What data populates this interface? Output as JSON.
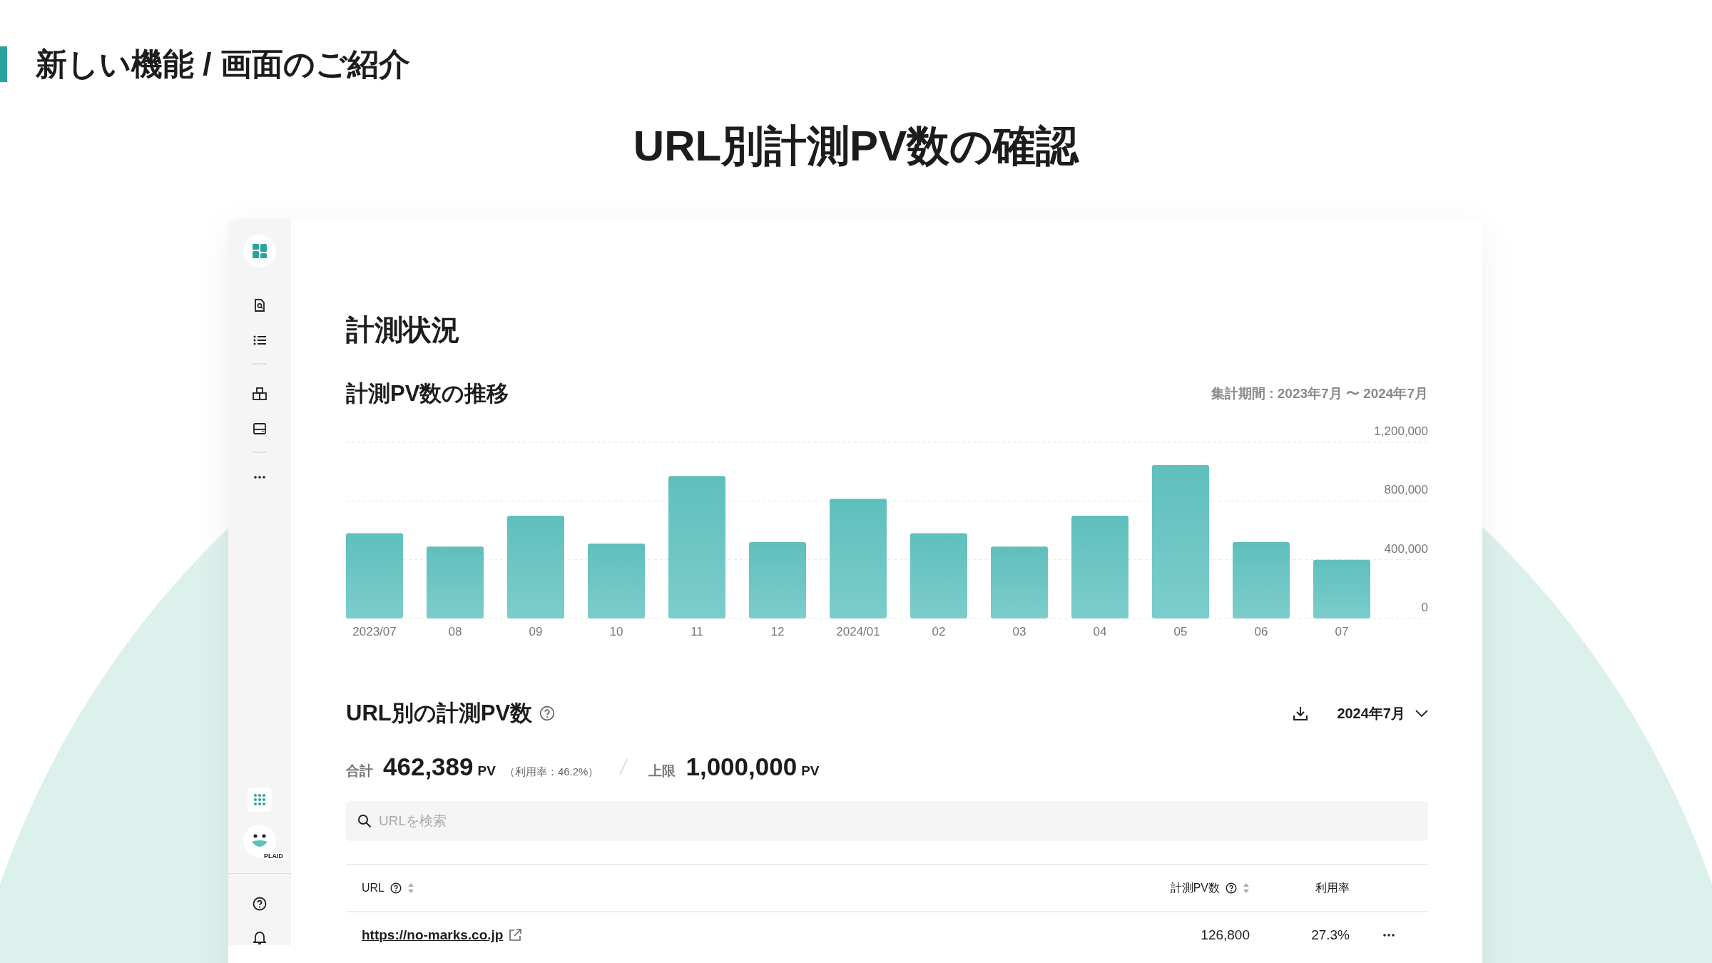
{
  "slide": {
    "heading": "新しい機能 / 画面のご紹介",
    "title": "URL別計測PV数の確認"
  },
  "sidebar": {
    "avatar_badge": "PLAID"
  },
  "page": {
    "title": "計測状況"
  },
  "trend": {
    "title": "計測PV数の推移",
    "period": "集計期間 : 2023年7月 〜 2024年7月",
    "chart_data": {
      "type": "bar",
      "categories": [
        "2023/07",
        "08",
        "09",
        "10",
        "11",
        "12",
        "2024/01",
        "02",
        "03",
        "04",
        "05",
        "06",
        "07"
      ],
      "series": [
        {
          "color": "#5fbfbd",
          "values": [
            580000,
            490000,
            700000,
            510000,
            970000,
            520000,
            815000,
            580000,
            490000,
            700000,
            1045000,
            520000,
            400000
          ]
        }
      ],
      "ylim": [
        0,
        1200000
      ],
      "yticks": [
        {
          "value": 0,
          "label": "0"
        },
        {
          "value": 400000,
          "label": "400,000"
        },
        {
          "value": 800000,
          "label": "800,000"
        },
        {
          "value": 1200000,
          "label": "1,200,000"
        }
      ]
    }
  },
  "url_section": {
    "title": "URL別の計測PV数",
    "month": "2024年7月",
    "total_label": "合計",
    "total": "462,389",
    "total_unit": "PV",
    "usage": "（利用率：46.2%）",
    "limit_label": "上限",
    "limit": "1,000,000",
    "limit_unit": "PV",
    "search": {
      "placeholder": "URLを検索"
    },
    "columns": [
      {
        "label": "URL",
        "help": true,
        "sortable": true
      },
      {
        "label": "計測PV数",
        "help": true,
        "sortable": true
      },
      {
        "label": "利用率",
        "help": false,
        "sortable": false
      }
    ],
    "rows": [
      {
        "url": "https://no-marks.co.jp",
        "pv": "126,800",
        "rate": "27.3%"
      }
    ]
  }
}
